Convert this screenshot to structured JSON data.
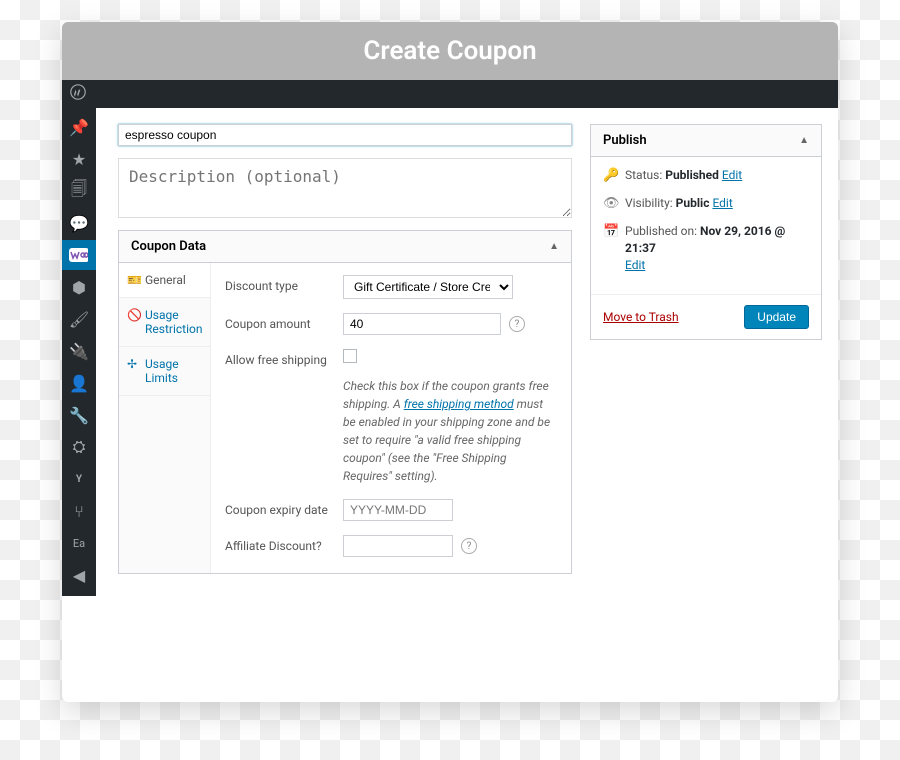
{
  "window": {
    "title": "Create Coupon"
  },
  "editor": {
    "title_value": "espresso coupon",
    "description_placeholder": "Description (optional)"
  },
  "coupon_panel": {
    "heading": "Coupon Data",
    "tabs": {
      "general": "General",
      "usage_restriction": "Usage Restriction",
      "usage_limits": "Usage Limits"
    },
    "fields": {
      "discount_type_label": "Discount type",
      "discount_type_value": "Gift Certificate / Store Credit",
      "coupon_amount_label": "Coupon amount",
      "coupon_amount_value": "40",
      "allow_free_shipping_label": "Allow free shipping",
      "shipping_desc_part1": "Check this box if the coupon grants free shipping. A ",
      "shipping_desc_link": "free shipping method",
      "shipping_desc_part2": " must be enabled in your shipping zone and be set to require \"a valid free shipping coupon\" (see the \"Free Shipping Requires\" setting).",
      "expiry_label": "Coupon expiry date",
      "expiry_placeholder": "YYYY-MM-DD",
      "affiliate_label": "Affiliate Discount?"
    }
  },
  "publish": {
    "heading": "Publish",
    "status_label": "Status:",
    "status_value": "Published",
    "visibility_label": "Visibility:",
    "visibility_value": "Public",
    "published_label": "Published on:",
    "published_value": "Nov 29, 2016 @ 21:37",
    "edit_label": "Edit",
    "trash_label": "Move to Trash",
    "update_label": "Update"
  },
  "sidemenu_icons": [
    "pin",
    "star",
    "pages",
    "comments",
    "woo",
    "products",
    "appearance",
    "plugins",
    "users",
    "tools",
    "settings",
    "seo",
    "share",
    "ea",
    "avatar"
  ]
}
